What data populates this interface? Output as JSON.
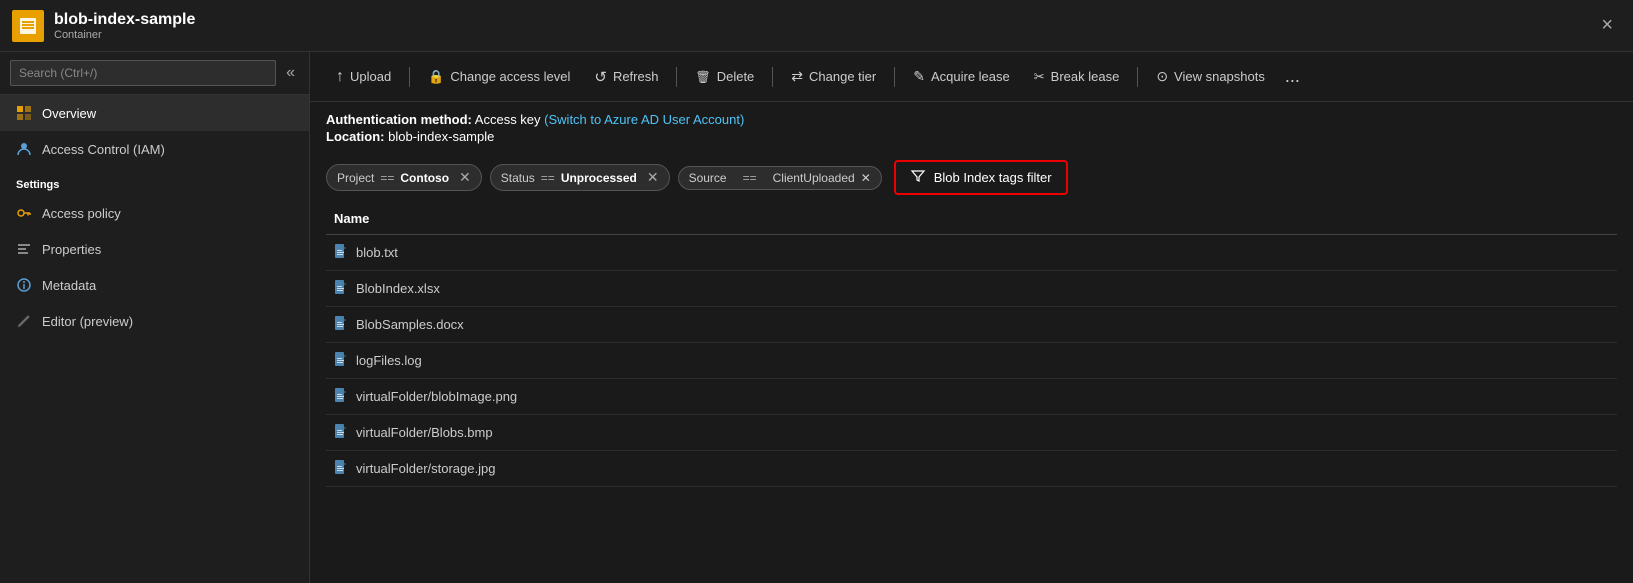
{
  "titlebar": {
    "icon_label": "container",
    "title": "blob-index-sample",
    "subtitle": "Container",
    "close_label": "×"
  },
  "sidebar": {
    "search_placeholder": "Search (Ctrl+/)",
    "collapse_label": "«",
    "nav_items": [
      {
        "id": "overview",
        "label": "Overview",
        "icon": "overview",
        "active": true
      },
      {
        "id": "iam",
        "label": "Access Control (IAM)",
        "icon": "iam",
        "active": false
      }
    ],
    "settings_label": "Settings",
    "settings_items": [
      {
        "id": "access-policy",
        "label": "Access policy",
        "icon": "policy"
      },
      {
        "id": "properties",
        "label": "Properties",
        "icon": "props"
      },
      {
        "id": "metadata",
        "label": "Metadata",
        "icon": "meta"
      },
      {
        "id": "editor",
        "label": "Editor (preview)",
        "icon": "editor"
      }
    ]
  },
  "toolbar": {
    "upload_label": "Upload",
    "change_access_label": "Change access level",
    "refresh_label": "Refresh",
    "delete_label": "Delete",
    "change_tier_label": "Change tier",
    "acquire_lease_label": "Acquire lease",
    "break_lease_label": "Break lease",
    "view_snapshots_label": "View snapshots",
    "more_label": "..."
  },
  "auth": {
    "method_label": "Authentication method:",
    "method_value": "Access key",
    "switch_link": "(Switch to Azure AD User Account)",
    "location_label": "Location:",
    "location_value": "blob-index-sample"
  },
  "filters": {
    "filter1": {
      "key": "Project",
      "operator": "==",
      "value": "Contoso"
    },
    "filter2": {
      "key": "Status",
      "operator": "==",
      "value": "Unprocessed"
    },
    "filter3_key": "Source",
    "filter3_operator": "==",
    "filter3_value": "ClientUploaded",
    "blob_index_btn_label": "Blob Index tags filter"
  },
  "table": {
    "col_name": "Name",
    "rows": [
      {
        "name": "blob.txt"
      },
      {
        "name": "BlobIndex.xlsx"
      },
      {
        "name": "BlobSamples.docx"
      },
      {
        "name": "logFiles.log"
      },
      {
        "name": "virtualFolder/blobImage.png"
      },
      {
        "name": "virtualFolder/Blobs.bmp"
      },
      {
        "name": "virtualFolder/storage.jpg"
      }
    ]
  }
}
